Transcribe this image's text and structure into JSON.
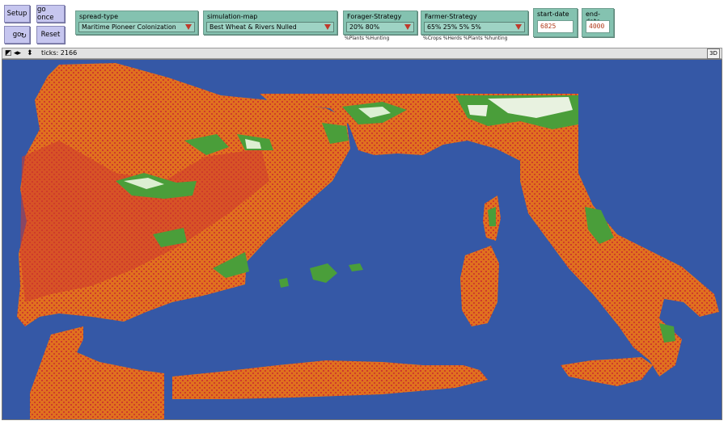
{
  "buttons": {
    "setup": "Setup",
    "go_once": "go once",
    "go": "go",
    "go_forever_glyph": "↻",
    "reset": "Reset"
  },
  "choosers": {
    "spread_type": {
      "label": "spread-type",
      "value": "Maritime Pioneer Colonization"
    },
    "simulation_map": {
      "label": "simulation-map",
      "value": "Best Wheat & Rivers Nulled"
    },
    "forager_strategy": {
      "label": "Forager-Strategy",
      "value": "20% 80%",
      "note": "%Plants %Hunting"
    },
    "farmer_strategy": {
      "label": "Farmer-Strategy",
      "value": "65%  25%  5%  5%",
      "note": "%Crops %Herds %Plants %hunting"
    }
  },
  "inputs": {
    "start_date": {
      "label": "start-date",
      "value": "6825"
    },
    "end_date": {
      "label": "end-date",
      "value": "4000"
    }
  },
  "view": {
    "ticks_label": "ticks: 2166",
    "threed_label": "3D"
  },
  "colors": {
    "sea": "#3558a6",
    "farmer": "#e0711f",
    "forager": "#cf3b2b",
    "unsettled": "#4a9e3a",
    "mountain": "#e8f2e0",
    "button_bg": "#c6c6ef",
    "widget_bg": "#84c2b0"
  }
}
